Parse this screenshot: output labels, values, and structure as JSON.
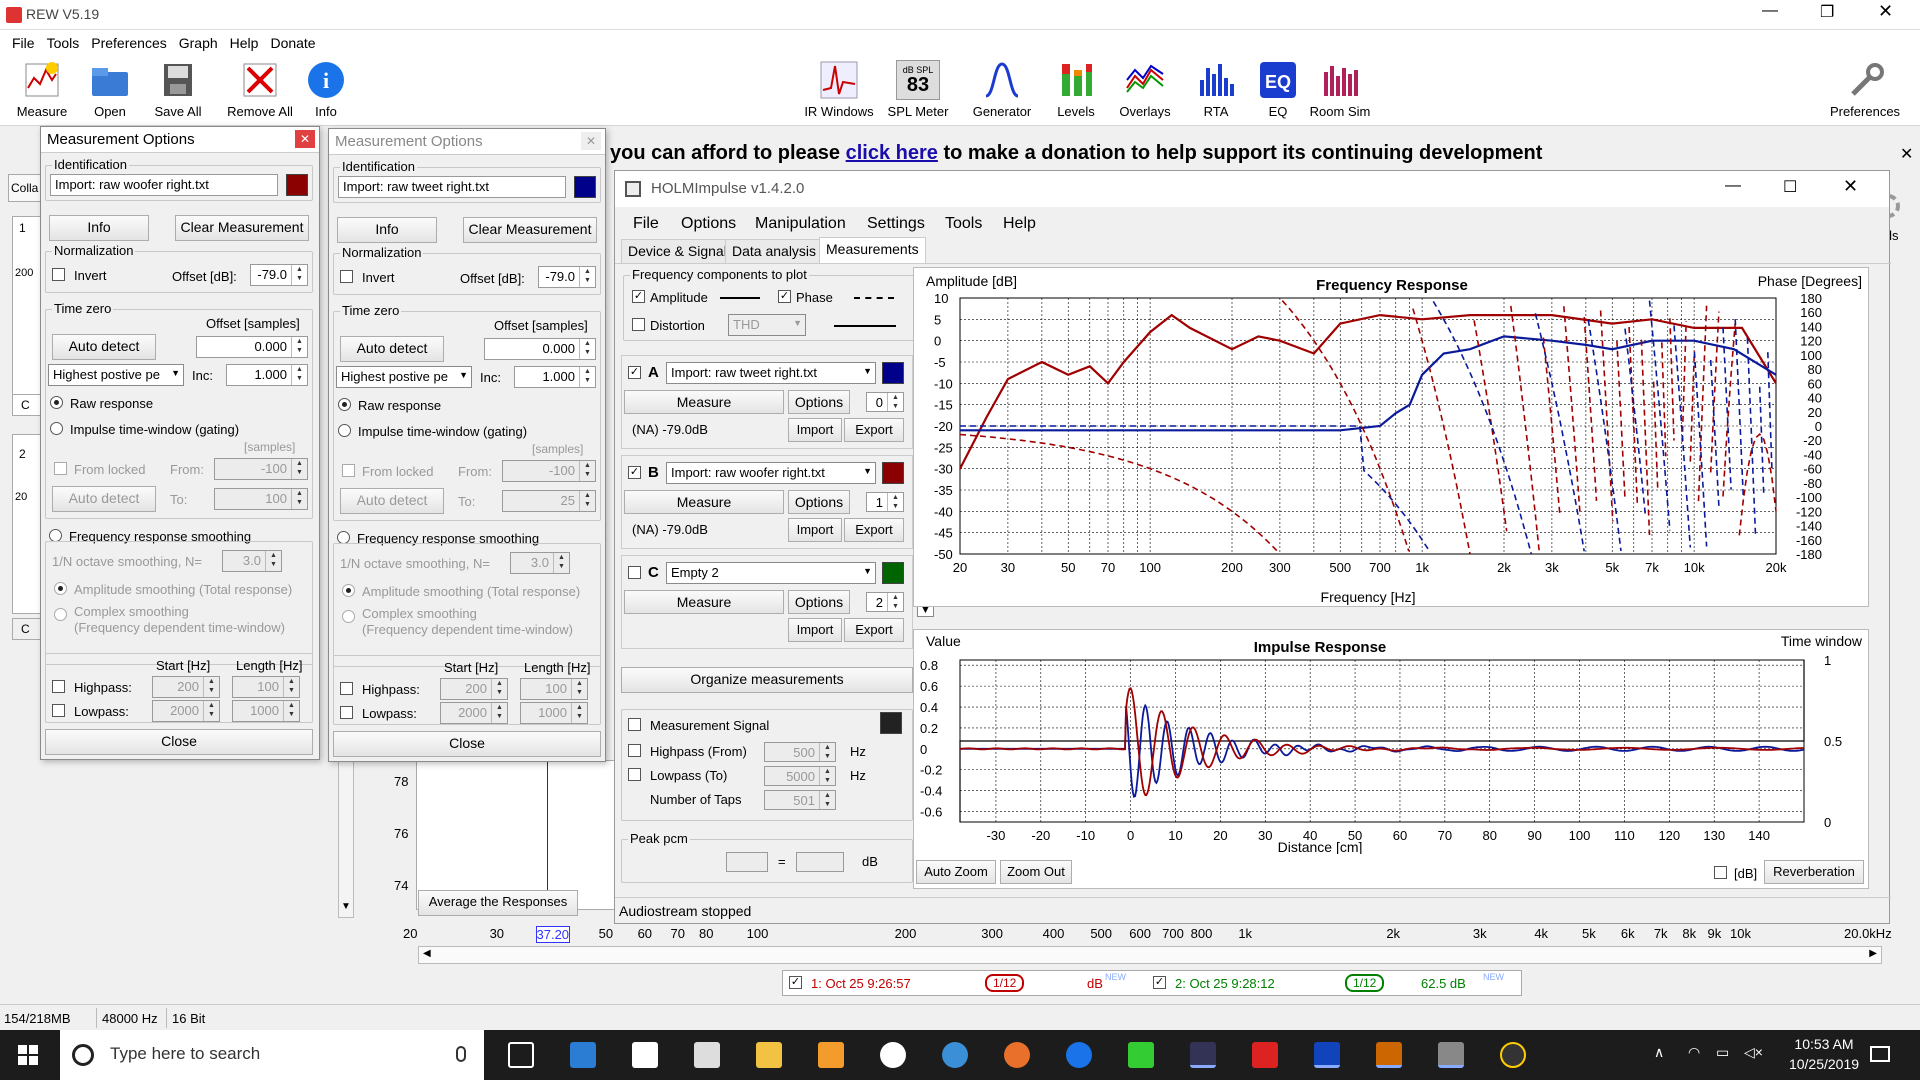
{
  "app": {
    "title": "REW V5.19",
    "menu": [
      "File",
      "Tools",
      "Preferences",
      "Graph",
      "Help",
      "Donate"
    ]
  },
  "toolbar_left": [
    "Measure",
    "Open",
    "Save All",
    "Remove All",
    "Info"
  ],
  "toolbar_right": [
    "IR Windows",
    "SPL Meter",
    "Generator",
    "Levels",
    "Overlays",
    "RTA",
    "EQ",
    "Room Sim"
  ],
  "spl_label": "dB SPL",
  "spl_value": "83",
  "preferences": "Preferences",
  "banner": {
    "before": "you can afford to please ",
    "link": "click here",
    "after": " to make a donation to help support its continuing development"
  },
  "controls_label": "trols",
  "side_fragment": [
    "Colla",
    "1",
    "200",
    "C",
    "2",
    "20",
    "C"
  ],
  "mo": [
    {
      "title": "Measurement Options",
      "identification": "Identification",
      "name": "Import: raw woofer right.txt",
      "color": "#8b0000",
      "info": "Info",
      "clear": "Clear Measurement",
      "normalization": "Normalization",
      "invert": "Invert",
      "offset_label": "Offset [dB]:",
      "offset": "-79.0",
      "timezero": "Time zero",
      "offset_samples": "Offset [samples]",
      "auto_detect": "Auto detect",
      "samples": "0.000",
      "peak_sel": "Highest postive pe",
      "inc_label": "Inc:",
      "inc": "1.000",
      "raw": "Raw response",
      "gating": "Impulse time-window (gating)",
      "samples_unit": "[samples]",
      "from_locked": "From locked",
      "from_label": "From:",
      "from": "-100",
      "auto_detect2": "Auto detect",
      "to_label": "To:",
      "to": "100",
      "freq_smooth": "Frequency response smoothing",
      "oct_label": "1/N octave smoothing, N=",
      "oct": "3.0",
      "amp_smooth": "Amplitude smoothing (Total response)",
      "cx_smooth": "Complex smoothing",
      "cx_smooth2": "(Frequency dependent time-window)",
      "start_hz": "Start [Hz]",
      "length_hz": "Length [Hz]",
      "highpass": "Highpass:",
      "hp_start": "200",
      "hp_len": "100",
      "lowpass": "Lowpass:",
      "lp_start": "2000",
      "lp_len": "1000",
      "close": "Close"
    },
    {
      "title": "Measurement Options",
      "identification": "Identification",
      "name": "Import: raw tweet right.txt",
      "color": "#00008b",
      "info": "Info",
      "clear": "Clear Measurement",
      "normalization": "Normalization",
      "invert": "Invert",
      "offset_label": "Offset [dB]:",
      "offset": "-79.0",
      "timezero": "Time zero",
      "offset_samples": "Offset [samples]",
      "auto_detect": "Auto detect",
      "samples": "0.000",
      "peak_sel": "Highest postive pe",
      "inc_label": "Inc:",
      "inc": "1.000",
      "raw": "Raw response",
      "gating": "Impulse time-window (gating)",
      "samples_unit": "[samples]",
      "from_locked": "From locked",
      "from_label": "From:",
      "from": "-100",
      "auto_detect2": "Auto detect",
      "to_label": "To:",
      "to": "25",
      "freq_smooth": "Frequency response smoothing",
      "oct_label": "1/N octave smoothing, N=",
      "oct": "3.0",
      "amp_smooth": "Amplitude smoothing (Total response)",
      "cx_smooth": "Complex smoothing",
      "cx_smooth2": "(Frequency dependent time-window)",
      "start_hz": "Start [Hz]",
      "length_hz": "Length [Hz]",
      "highpass": "Highpass:",
      "hp_start": "200",
      "hp_len": "100",
      "lowpass": "Lowpass:",
      "lp_start": "2000",
      "lp_len": "1000",
      "close": "Close"
    }
  ],
  "holm": {
    "title": "HOLMImpulse  v1.4.2.0",
    "menu": [
      "File",
      "Options",
      "Manipulation",
      "Settings",
      "Tools",
      "Help"
    ],
    "tabs": [
      "Device & Signal",
      "Data analysis",
      "Measurements"
    ],
    "fc_title": "Frequency components to plot",
    "amplitude": "Amplitude",
    "phase": "Phase",
    "distortion": "Distortion",
    "thd": "THD",
    "channels": [
      {
        "letter": "A",
        "checked": true,
        "name": "Import: raw tweet right.txt",
        "color": "#00008b",
        "measure": "Measure",
        "options": "Options",
        "idx": "0",
        "level": "(NA) -79.0dB",
        "import": "Import",
        "export": "Export"
      },
      {
        "letter": "B",
        "checked": true,
        "name": "Import: raw woofer right.txt",
        "color": "#8b0000",
        "measure": "Measure",
        "options": "Options",
        "idx": "1",
        "level": "(NA) -79.0dB",
        "import": "Import",
        "export": "Export"
      },
      {
        "letter": "C",
        "checked": false,
        "name": "Empty 2",
        "color": "#006400",
        "measure": "Measure",
        "options": "Options",
        "idx": "2",
        "level": "",
        "import": "Import",
        "export": "Export"
      }
    ],
    "organize": "Organize measurements",
    "meas_signal": "Measurement Signal",
    "hp_from": "Highpass (From)",
    "hp_val": "500",
    "hz": "Hz",
    "lp_to": "Lowpass (To)",
    "lp_val": "5000",
    "taps": "Number of Taps",
    "taps_val": "501",
    "peak_pcm": "Peak pcm",
    "eq": "=",
    "db": "dB",
    "status": "Audiostream stopped",
    "auto_zoom": "Auto Zoom",
    "zoom_out": "Zoom Out",
    "db_check": "[dB]",
    "reverberation": "Reverberation"
  },
  "fr_chart": {
    "title": "Frequency Response",
    "ylabel": "Amplitude [dB]",
    "y2label": "Phase [Degrees]",
    "xlabel": "Frequency [Hz]",
    "yticks": [
      "10",
      "5",
      "0",
      "-5",
      "-10",
      "-15",
      "-20",
      "-25",
      "-30",
      "-35",
      "-40",
      "-45",
      "-50"
    ],
    "y2ticks": [
      "180",
      "160",
      "140",
      "120",
      "100",
      "80",
      "60",
      "40",
      "20",
      "0",
      "-20",
      "-40",
      "-60",
      "-80",
      "-100",
      "-120",
      "-140",
      "-160",
      "-180"
    ],
    "xticks": [
      "20",
      "30",
      "50",
      "70",
      "100",
      "200",
      "300",
      "500",
      "700",
      "1k",
      "2k",
      "3k",
      "5k",
      "7k",
      "10k",
      "20k"
    ]
  },
  "ir_chart": {
    "title": "Impulse Response",
    "ylabel": "Value",
    "y2label": "Time window",
    "xlabel": "Distance [cm]",
    "yticks": [
      "0.8",
      "0.6",
      "0.4",
      "0.2",
      "0",
      "-0.2",
      "-0.4",
      "-0.6"
    ],
    "y2ticks": [
      "1",
      "0.5",
      "0"
    ],
    "xticks": [
      "-30",
      "-20",
      "-10",
      "0",
      "10",
      "20",
      "30",
      "40",
      "50",
      "60",
      "70",
      "80",
      "90",
      "100",
      "110",
      "120",
      "130",
      "140"
    ]
  },
  "rew_bottom": {
    "spl_ticks": [
      "78",
      "76",
      "74"
    ],
    "avg": "Average the Responses",
    "freq_ticks": [
      "20",
      "30",
      "37.20",
      "50",
      "60",
      "70",
      "80",
      "100",
      "200",
      "300",
      "400",
      "500",
      "600",
      "700",
      "800",
      "1k",
      "2k",
      "3k",
      "4k",
      "5k",
      "6k",
      "7k",
      "8k",
      "9k",
      "10k",
      "20.0kHz"
    ],
    "legend": [
      {
        "label": "1: Oct 25 9:26:57",
        "smooth": "1/12",
        "value": "dB",
        "new": "NEW",
        "color": "#c00000"
      },
      {
        "label": "2: Oct 25 9:28:12",
        "smooth": "1/12",
        "value": "62.5 dB",
        "new": "NEW",
        "color": "#008000"
      }
    ]
  },
  "statusbar": {
    "mem": "154/218MB",
    "rate": "48000 Hz",
    "bits": "16 Bit"
  },
  "taskbar": {
    "search": "Type here to search",
    "time": "10:53 AM",
    "date": "10/25/2019"
  }
}
